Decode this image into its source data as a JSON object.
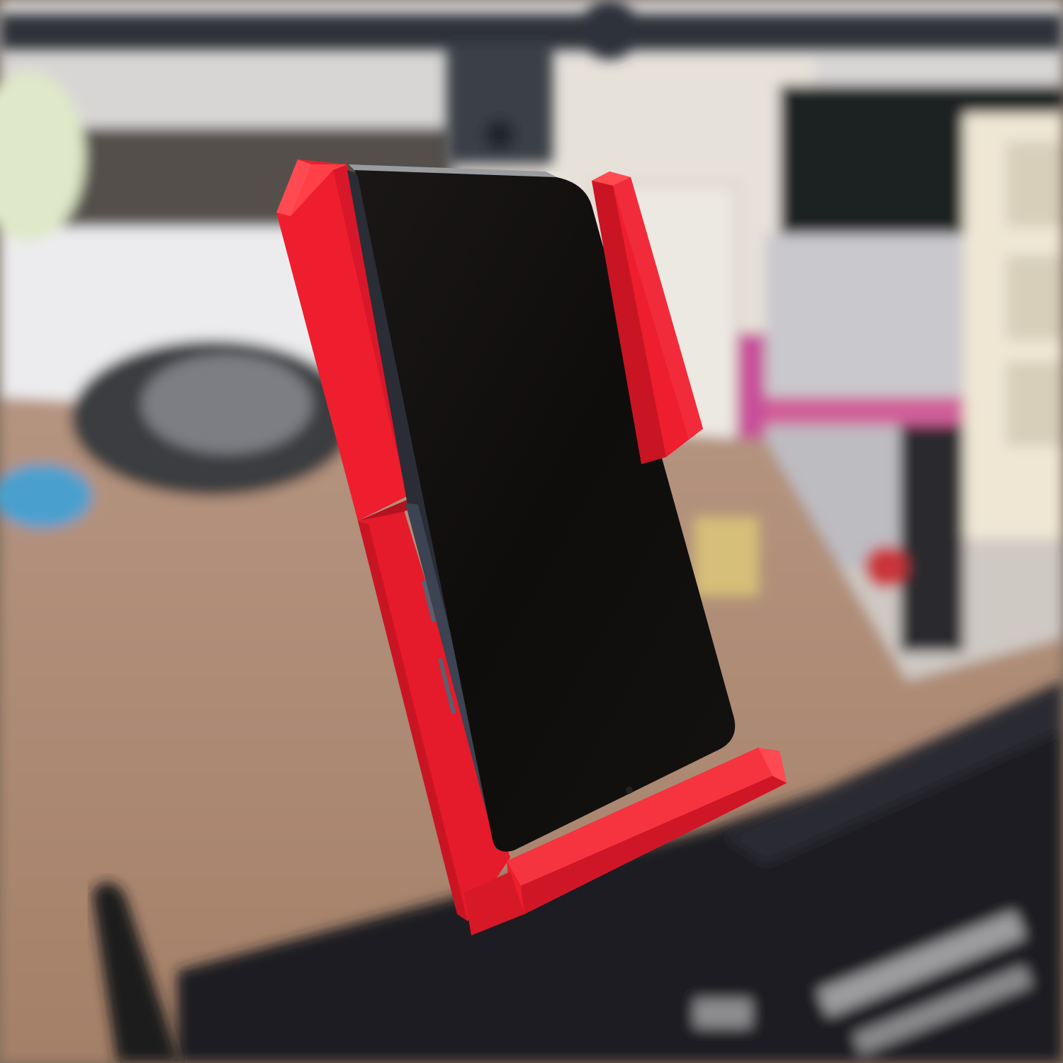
{
  "scene": {
    "subject": "red-phone-holder-with-black-smartphone",
    "palette": {
      "holder_red": "#ee1e2e",
      "holder_shadow": "#b3121f",
      "holder_highlight": "#ff4a52",
      "phone_screen": "#0f0d0c",
      "phone_frame": "#2a2d35",
      "carpet": "#b08c73",
      "wall": "#e9e9ea",
      "door": "#e2ddd5",
      "rail": "#2d3138",
      "desk": "#1e1f22"
    }
  }
}
